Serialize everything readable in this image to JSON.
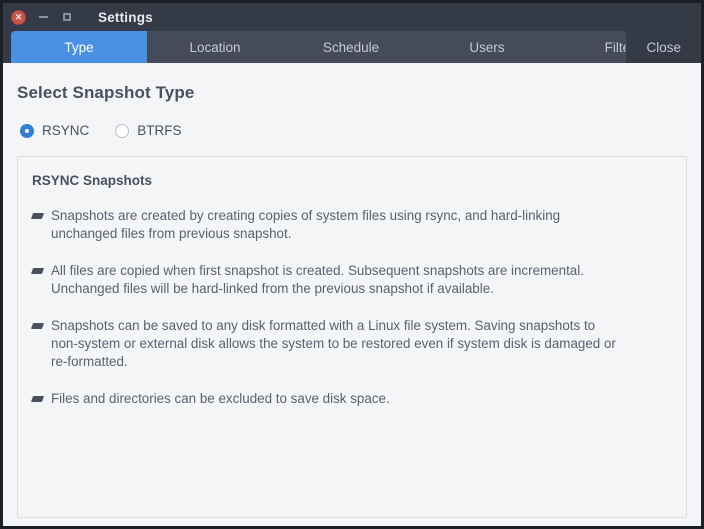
{
  "window": {
    "title": "Settings",
    "controls": {
      "close_icon": "close-x-icon",
      "close_glyph": "✕",
      "minimize_icon": "minimize-icon",
      "maximize_icon": "maximize-icon"
    }
  },
  "tabs": [
    {
      "label": "Type",
      "active": true
    },
    {
      "label": "Location",
      "active": false
    },
    {
      "label": "Schedule",
      "active": false
    },
    {
      "label": "Users",
      "active": false
    },
    {
      "label": "Filters",
      "active": false
    }
  ],
  "toolbar": {
    "close_label": "Close"
  },
  "main": {
    "page_title": "Select Snapshot Type",
    "options": [
      {
        "label": "RSYNC",
        "selected": true
      },
      {
        "label": "BTRFS",
        "selected": false
      }
    ],
    "panel": {
      "title": "RSYNC Snapshots",
      "items": [
        {
          "line1": "Snapshots are created by creating copies of system files using rsync, and hard-linking",
          "line2": "unchanged files from previous snapshot.",
          "line3": ""
        },
        {
          "line1": "All files are copied when first snapshot is created. Subsequent snapshots are incremental.",
          "line2": "Unchanged files will be hard-linked from the previous snapshot if available.",
          "line3": ""
        },
        {
          "line1": "Snapshots can be saved to any disk formatted with a Linux file system. Saving snapshots to",
          "line2": "non-system or external disk allows the system to be restored even if system disk is damaged or",
          "line3": "re-formatted."
        },
        {
          "line1": "Files and directories can be excluded to save disk space.",
          "line2": "",
          "line3": ""
        }
      ]
    }
  },
  "colors": {
    "titlebar_bg": "#343a46",
    "tab_inactive_bg": "#454b59",
    "tab_active_bg": "#4a90e2",
    "content_bg": "#f4f5f7",
    "text_dark": "#4a515e",
    "accent": "#2f7fd4",
    "close_button": "#c9544c"
  }
}
